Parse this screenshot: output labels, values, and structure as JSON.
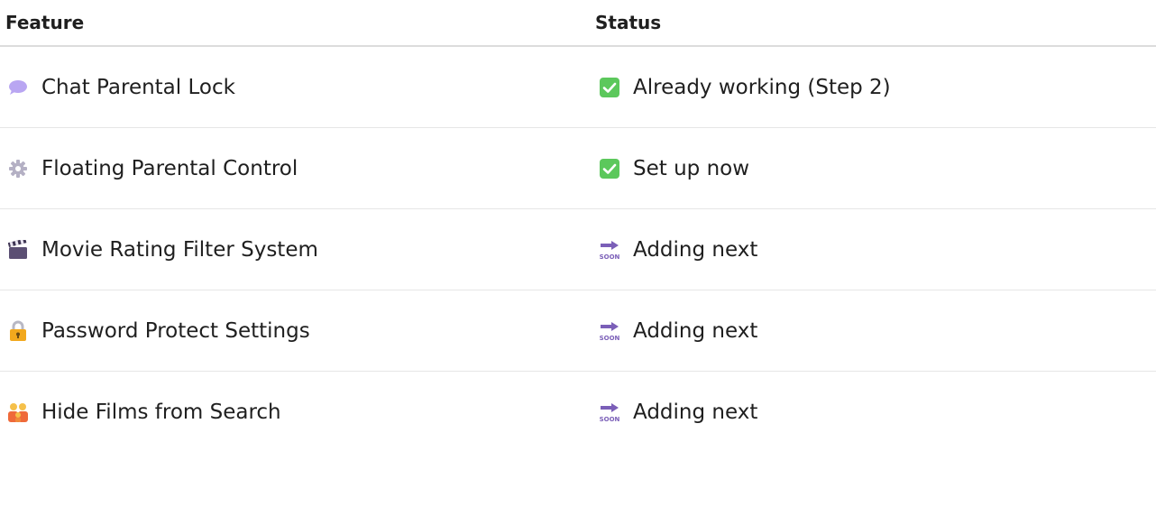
{
  "table": {
    "headers": {
      "feature": "Feature",
      "status": "Status"
    },
    "rows": [
      {
        "feature": "Chat Parental Lock",
        "feature_icon": "speech-bubble-icon",
        "status": "Already working (Step 2)",
        "status_icon": "check-box-icon"
      },
      {
        "feature": "Floating Parental Control",
        "feature_icon": "gear-icon",
        "status": "Set up now",
        "status_icon": "check-box-icon"
      },
      {
        "feature": "Movie Rating Filter System",
        "feature_icon": "clapper-board-icon",
        "status": "Adding next",
        "status_icon": "soon-arrow-icon"
      },
      {
        "feature": "Password Protect Settings",
        "feature_icon": "lock-icon",
        "status": "Adding next",
        "status_icon": "soon-arrow-icon"
      },
      {
        "feature": "Hide Films from Search",
        "feature_icon": "family-icon",
        "status": "Adding next",
        "status_icon": "soon-arrow-icon"
      }
    ]
  },
  "colors": {
    "check_green": "#5cc85c",
    "soon_purple": "#7b5fb8",
    "bubble_purple": "#b9a6f2"
  }
}
